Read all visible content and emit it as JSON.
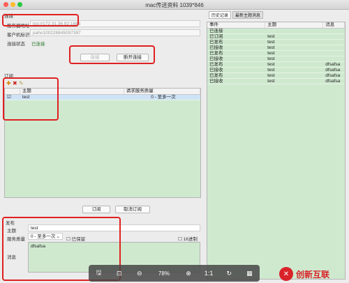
{
  "window": {
    "title": "mac传送资料 1039*846"
  },
  "connection": {
    "section_label": "连接",
    "server_label": "服务器地址",
    "server_value": "tcp://172.31.36.92:1883",
    "client_label": "客户机标识",
    "client_value": "paho100228845097387",
    "status_label": "连接状态",
    "status_value": "已连接",
    "connect_label": "连接",
    "reconnect_label": "断开连接"
  },
  "subscribe": {
    "section_label": "订阅",
    "columns": [
      "主题",
      "请求服务质量"
    ],
    "rows": [
      {
        "topic": "test",
        "qos": "0 - 至多一次"
      }
    ],
    "subscribe_btn": "订阅",
    "unsubscribe_btn": "取消订阅"
  },
  "publish": {
    "section_label": "发布",
    "topic_label": "主题",
    "topic_value": "test",
    "qos_label": "服务质量",
    "qos_value": "0 - 至多一次",
    "retain_label": "已保留",
    "hex_label": "16进制",
    "message_label": "消息",
    "message_value": "dfsafsa"
  },
  "history": {
    "tabs": [
      "历史记录",
      "最新主题消息"
    ],
    "columns": [
      "事件",
      "主题",
      "消息"
    ],
    "rows": [
      {
        "event": "已连接",
        "topic": "",
        "msg": ""
      },
      {
        "event": "已订阅",
        "topic": "test",
        "msg": ""
      },
      {
        "event": "已发布",
        "topic": "test",
        "msg": ""
      },
      {
        "event": "已接收",
        "topic": "test",
        "msg": ""
      },
      {
        "event": "已发布",
        "topic": "test",
        "msg": ""
      },
      {
        "event": "已接收",
        "topic": "test",
        "msg": ""
      },
      {
        "event": "已发布",
        "topic": "test",
        "msg": "dfsafsa"
      },
      {
        "event": "已接收",
        "topic": "test",
        "msg": "dfsafsa"
      },
      {
        "event": "已发布",
        "topic": "test",
        "msg": "dfsafsa"
      },
      {
        "event": "已接收",
        "topic": "test",
        "msg": "dfsafsa"
      }
    ]
  },
  "viewer_toolbar": {
    "zoom": "78%"
  },
  "watermark": {
    "text": "创新互联"
  }
}
